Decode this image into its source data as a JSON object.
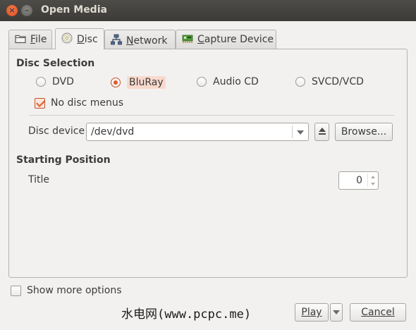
{
  "window": {
    "title": "Open Media",
    "close_glyph": "×",
    "minimize_glyph": "–"
  },
  "tabs": [
    {
      "label": "File",
      "mnemonic": "F",
      "rest": "ile",
      "icon": "folder-icon"
    },
    {
      "label": "Disc",
      "mnemonic": "D",
      "rest": "isc",
      "icon": "disc-icon",
      "active": true
    },
    {
      "label": "Network",
      "mnemonic": "N",
      "rest": "etwork",
      "icon": "network-icon"
    },
    {
      "label": "Capture Device",
      "mnemonic": "C",
      "rest": "apture Device",
      "icon": "capture-card-icon"
    }
  ],
  "disc_selection": {
    "title": "Disc Selection",
    "options": [
      {
        "label": "DVD",
        "checked": false
      },
      {
        "label": "BluRay",
        "checked": true
      },
      {
        "label": "Audio CD",
        "checked": false
      },
      {
        "label": "SVCD/VCD",
        "checked": false
      }
    ],
    "no_disc_menus": {
      "label": "No disc menus",
      "checked": true
    },
    "device_label": "Disc device",
    "device_value": "/dev/dvd",
    "browse_label": "Browse...",
    "eject_icon": "eject-icon"
  },
  "starting_position": {
    "title": "Starting Position",
    "title_label": "Title",
    "title_value": "0"
  },
  "footer": {
    "show_more_label": "Show more options",
    "show_more_checked": false,
    "play_label": "Play",
    "cancel_label": "Cancel",
    "watermark": "水电网(www.pcpc.me)"
  },
  "colors": {
    "accent": "#e05b2c",
    "titlebar": "#3c3b37",
    "background": "#f2f1f0"
  }
}
